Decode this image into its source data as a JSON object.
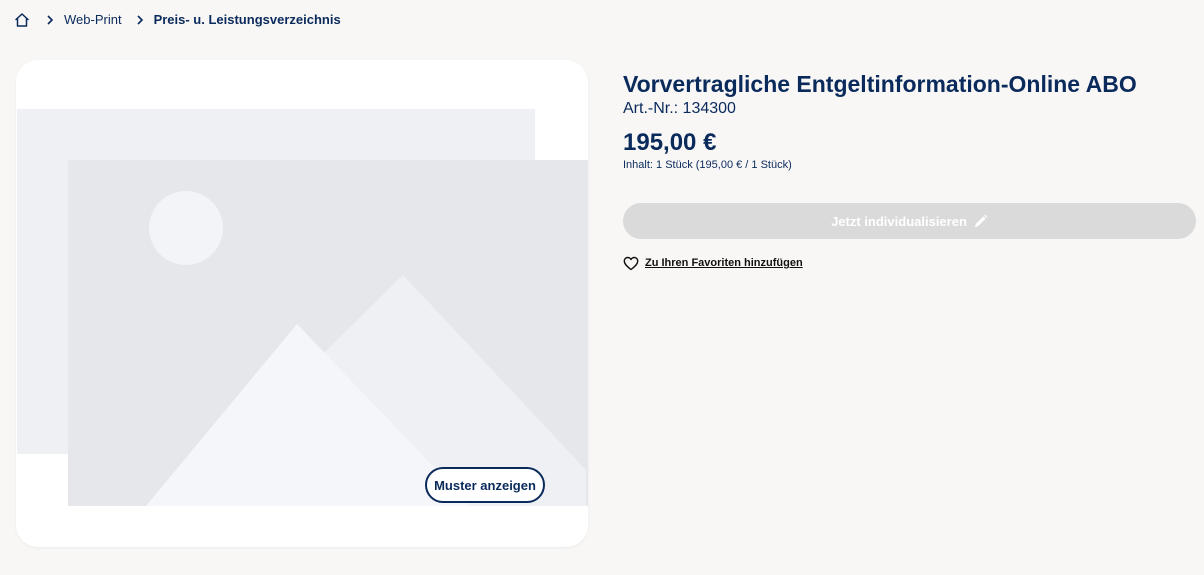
{
  "breadcrumb": {
    "home_icon": "home-icon",
    "items": [
      {
        "label": "Web-Print"
      },
      {
        "label": "Preis- u. Leistungsverzeichnis"
      }
    ]
  },
  "product_image": {
    "icon": "image-placeholder-icon",
    "sample_button_label": "Muster anzeigen"
  },
  "product": {
    "title": "Vorvertragliche Entgeltinformation-Online ABO",
    "article_number": "Art.-Nr.: 134300",
    "price": "195,00 €",
    "content_info": "Inhalt: 1 Stück (195,00 € / 1 Stück)",
    "individualize_label": "Jetzt individualisieren",
    "favorite_label": "Zu Ihren Favoriten hinzufügen"
  },
  "colors": {
    "brand": "#0a2a5c",
    "background": "#f8f7f6",
    "disabled_button": "#dadada"
  }
}
